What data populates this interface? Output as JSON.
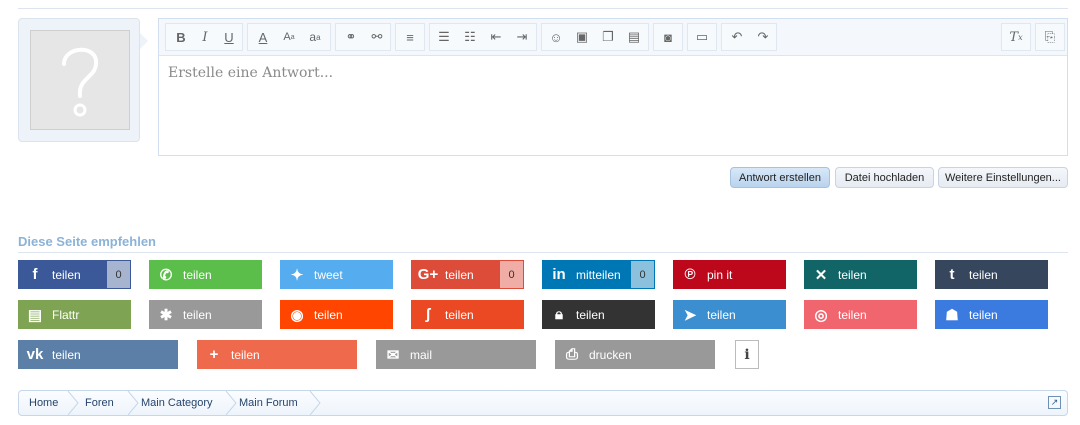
{
  "editor": {
    "placeholder": "Erstelle eine Antwort...",
    "toolbar": [
      "bold-icon",
      "italic-icon",
      "underline-icon",
      "font-color-icon",
      "font-size-icon",
      "font-family-icon",
      "link-icon",
      "unlink-icon",
      "align-icon",
      "bullet-list-icon",
      "numbered-list-icon",
      "outdent-icon",
      "indent-icon",
      "smilie-icon",
      "image-icon",
      "media-icon",
      "insert-template-icon",
      "camera-icon",
      "save-draft-icon",
      "undo-icon",
      "redo-icon",
      "remove-format-icon",
      "toggle-bbcode-icon"
    ]
  },
  "actions": {
    "reply": "Antwort erstellen",
    "upload": "Datei hochladen",
    "more": "Weitere Einstellungen..."
  },
  "share": {
    "title": "Diese Seite empfehlen",
    "items": [
      {
        "label": "teilen",
        "icon": "facebook-icon",
        "color": "#3b5998",
        "count": "0"
      },
      {
        "label": "teilen",
        "icon": "whatsapp-icon",
        "color": "#5cbe4a"
      },
      {
        "label": "tweet",
        "icon": "twitter-icon",
        "color": "#55acee"
      },
      {
        "label": "teilen",
        "icon": "google-plus-icon",
        "color": "#dd4b39",
        "count": "0"
      },
      {
        "label": "mitteilen",
        "icon": "linkedin-icon",
        "color": "#0077b5",
        "count": "0"
      },
      {
        "label": "pin it",
        "icon": "pinterest-icon",
        "color": "#bd081c"
      },
      {
        "label": "teilen",
        "icon": "xing-icon",
        "color": "#126567"
      },
      {
        "label": "teilen",
        "icon": "tumblr-icon",
        "color": "#36465d"
      },
      {
        "label": "Flattr",
        "icon": "flattr-icon",
        "color": "#7ea352"
      },
      {
        "label": "teilen",
        "icon": "asterisk-icon",
        "color": "#999999"
      },
      {
        "label": "teilen",
        "icon": "reddit-icon",
        "color": "#ff4500"
      },
      {
        "label": "teilen",
        "icon": "stumbleupon-icon",
        "color": "#eb4924"
      },
      {
        "label": "teilen",
        "icon": "lock-icon",
        "color": "#333333"
      },
      {
        "label": "teilen",
        "icon": "telegram-icon",
        "color": "#3b8fd0"
      },
      {
        "label": "teilen",
        "icon": "weibo-icon",
        "color": "#f0656e"
      },
      {
        "label": "teilen",
        "icon": "qq-icon",
        "color": "#3b7be0"
      },
      {
        "label": "teilen",
        "icon": "vk-icon",
        "color": "#5b7fa6"
      },
      {
        "label": "teilen",
        "icon": "plus-icon",
        "color": "#ef6a4c"
      },
      {
        "label": "mail",
        "icon": "mail-icon",
        "color": "#999999"
      },
      {
        "label": "drucken",
        "icon": "print-icon",
        "color": "#999999"
      }
    ],
    "info": "i"
  },
  "breadcrumb": [
    "Home",
    "Foren",
    "Main Category",
    "Main Forum"
  ]
}
